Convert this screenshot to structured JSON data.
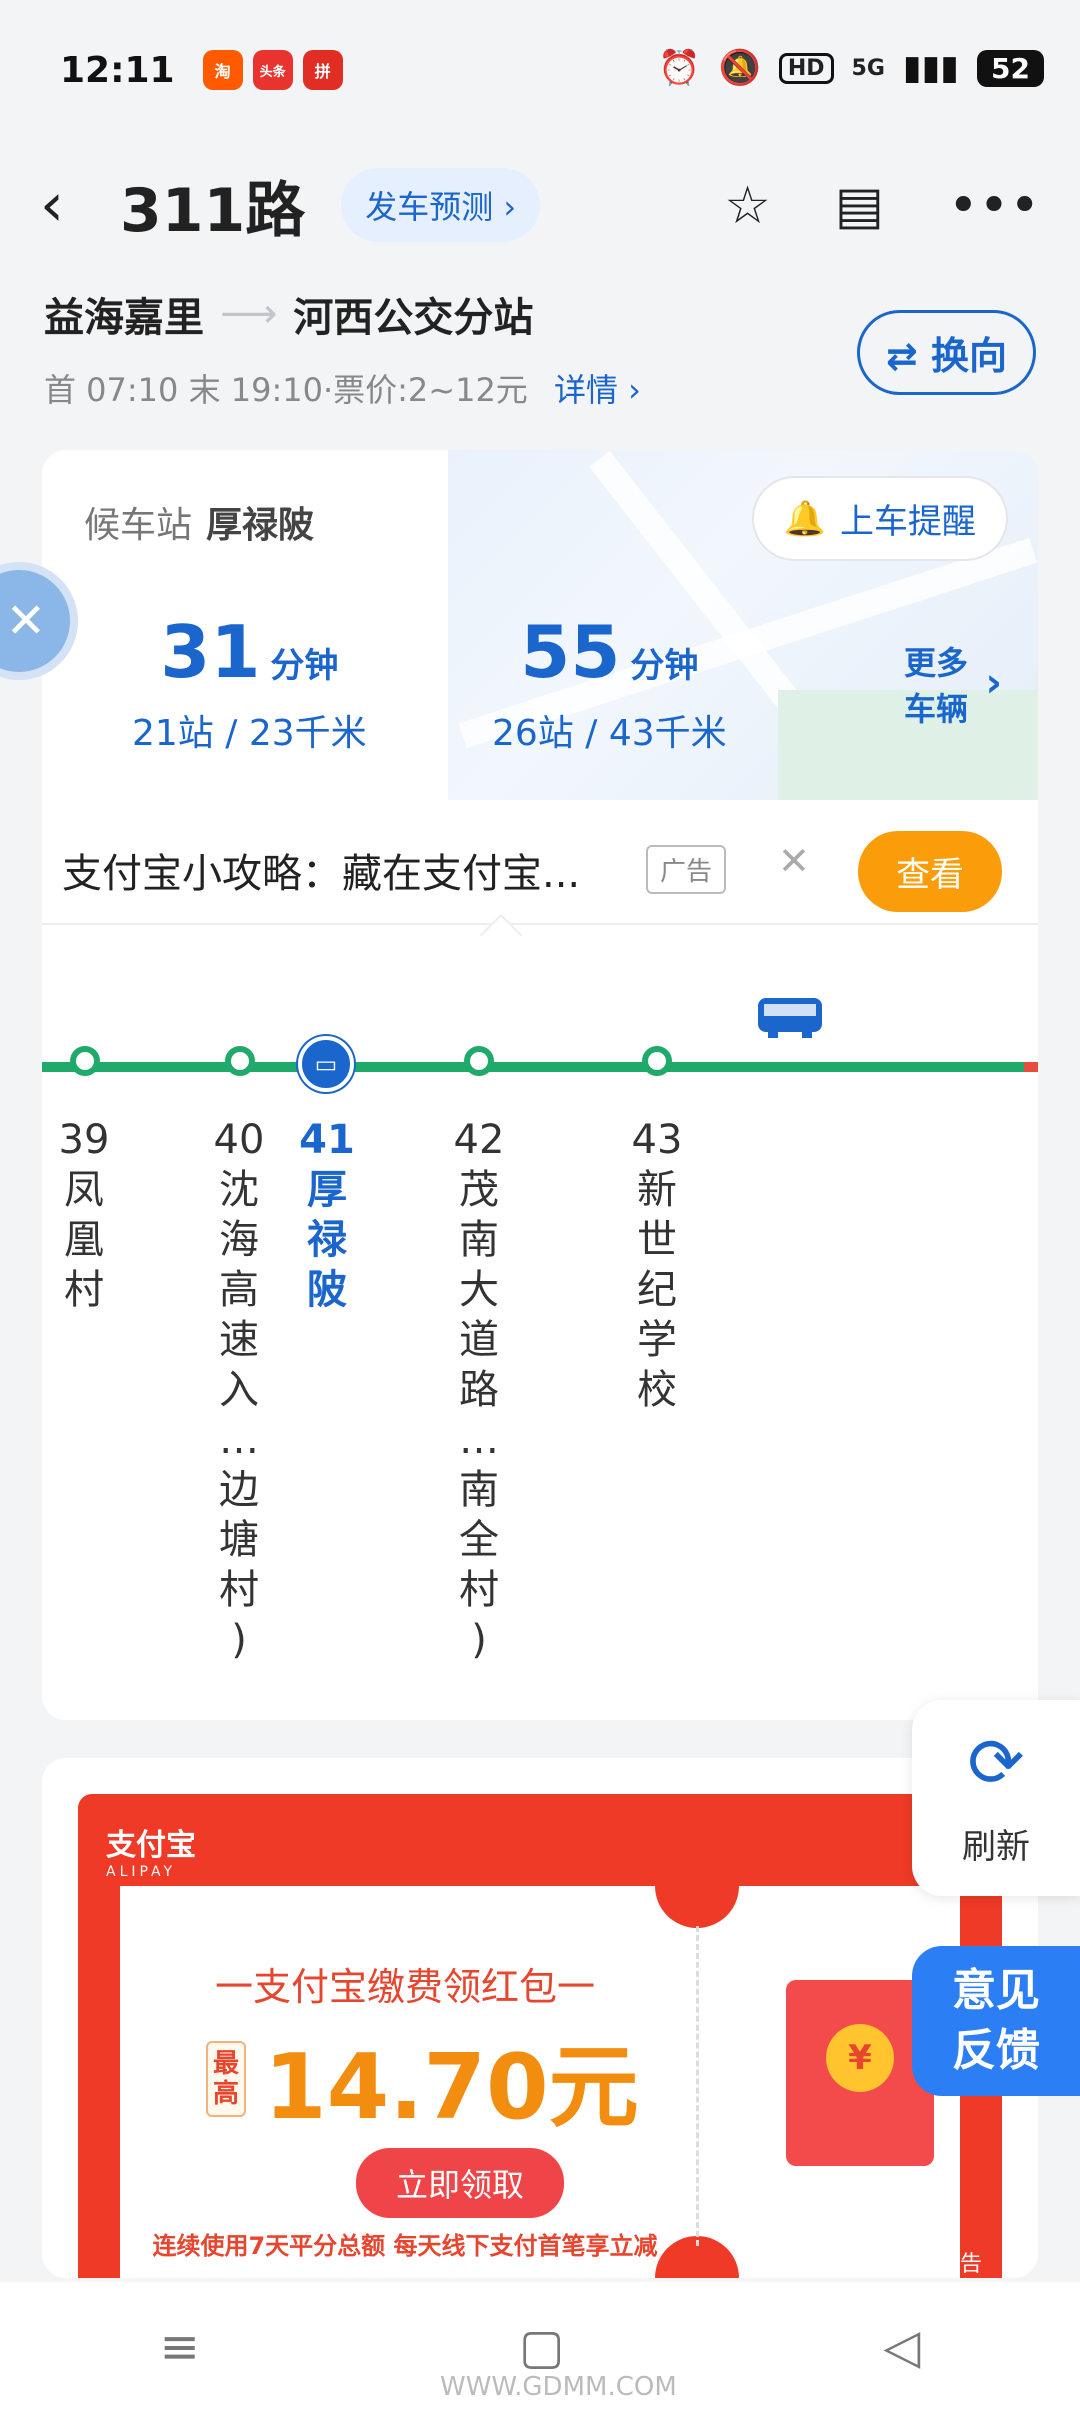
{
  "status_bar": {
    "time": "12:11",
    "apps": [
      "淘",
      "头条",
      "拼"
    ],
    "hd_badge": "HD",
    "network": "5G",
    "battery": "52"
  },
  "header": {
    "title": "311路",
    "prediction_button": "发车预测 ›"
  },
  "route": {
    "from": "益海嘉里",
    "to": "河西公交分站",
    "meta": "首 07:10 末 19:10·票价:2~12元",
    "detail_link": "详情 ›",
    "switch_button": "⇄ 换向"
  },
  "waiting": {
    "label": "候车站",
    "station": "厚禄陂",
    "remind_button": "上车提醒",
    "eta": [
      {
        "minutes": "31",
        "unit": "分钟",
        "sub": "21站 / 23千米"
      },
      {
        "minutes": "55",
        "unit": "分钟",
        "sub": "26站 / 43千米"
      }
    ],
    "more_vehicles_line1": "更多",
    "more_vehicles_line2": "车辆"
  },
  "ad_strip": {
    "text": "支付宝小攻略：藏在支付宝...",
    "tag": "广告",
    "view_button": "查看"
  },
  "stops": [
    {
      "no": "39",
      "name": [
        "凤",
        "凰",
        "村"
      ]
    },
    {
      "no": "40",
      "name": [
        "沈",
        "海",
        "高",
        "速",
        "入",
        "…",
        "边",
        "塘",
        "村",
        ")"
      ]
    },
    {
      "no": "41",
      "name": [
        "厚",
        "禄",
        "陂"
      ],
      "current": true
    },
    {
      "no": "42",
      "name": [
        "茂",
        "南",
        "大",
        "道",
        "路",
        "…",
        "南",
        "全",
        "村",
        ")"
      ]
    },
    {
      "no": "43",
      "name": [
        "新",
        "世",
        "纪",
        "学",
        "校"
      ]
    }
  ],
  "promo": {
    "logo": "支付宝",
    "logo_sub": "ALIPAY",
    "title": "一支付宝缴费领红包一",
    "max_tag": "最高",
    "amount": "14.70元",
    "claim_button": "立即领取",
    "note": "连续使用7天平分总额  每天线下支付首笔享立减",
    "coin": "¥",
    "ad_label": "广告"
  },
  "float": {
    "refresh_label": "刷新",
    "feedback_line1": "意见",
    "feedback_line2": "反馈"
  },
  "watermark": "WWW.GDMM.COM",
  "colors": {
    "accent": "#1a66cc",
    "line_green": "#1faa6b",
    "ad_orange": "#fb9d0b",
    "promo_red": "#ee3a26"
  }
}
